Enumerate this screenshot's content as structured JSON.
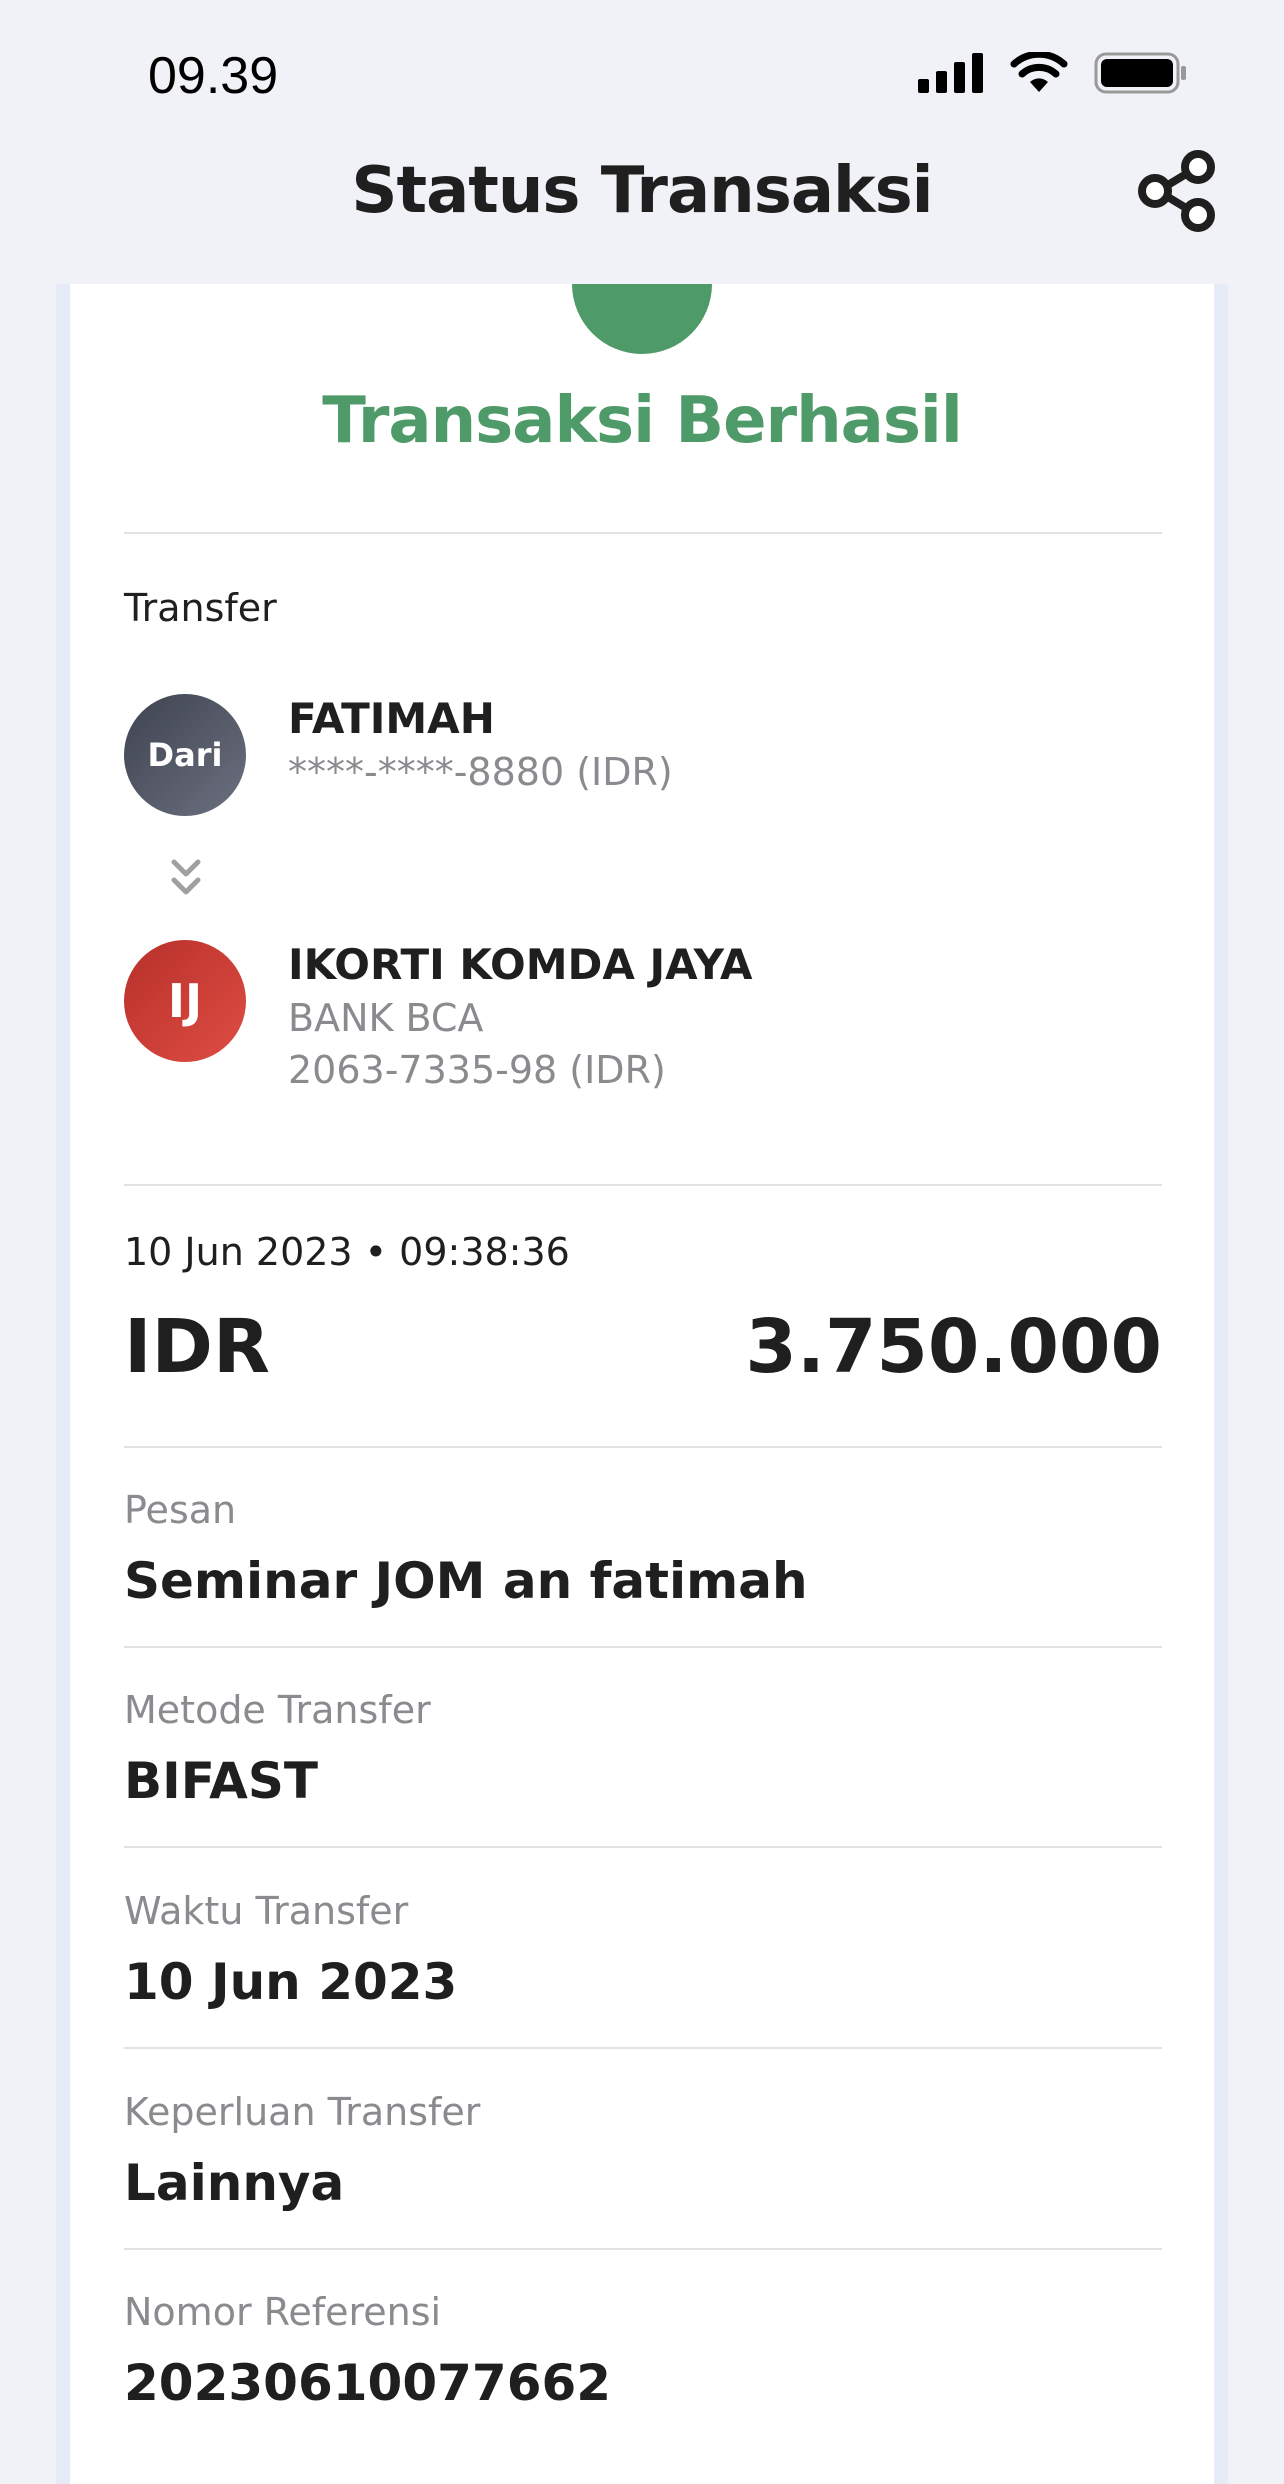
{
  "status_bar": {
    "time": "09.39"
  },
  "header": {
    "title": "Status Transaksi"
  },
  "result": {
    "title": "Transaksi Berhasil",
    "color": "#4e9a68"
  },
  "transfer": {
    "section_label": "Transfer",
    "from": {
      "avatar_text": "Dari",
      "name": "FATIMAH",
      "account": "****-****-8880 (IDR)"
    },
    "to": {
      "avatar_text": "IJ",
      "name": "IKORTI KOMDA JAYA",
      "bank": "BANK BCA",
      "account": "2063-7335-98 (IDR)"
    }
  },
  "datetime": "10 Jun 2023 • 09:38:36",
  "amount": {
    "currency": "IDR",
    "value": "3.750.000"
  },
  "details": [
    {
      "label": "Pesan",
      "value": "Seminar JOM an fatimah"
    },
    {
      "label": "Metode Transfer",
      "value": "BIFAST"
    },
    {
      "label": "Waktu Transfer",
      "value": "10 Jun 2023"
    },
    {
      "label": "Keperluan Transfer",
      "value": "Lainnya"
    },
    {
      "label": "Nomor Referensi",
      "value": "20230610077662"
    }
  ],
  "icons": {
    "signal": "cellular-signal-icon",
    "wifi": "wifi-icon",
    "battery": "battery-icon",
    "share": "share-icon",
    "down": "double-chevron-down-icon"
  }
}
